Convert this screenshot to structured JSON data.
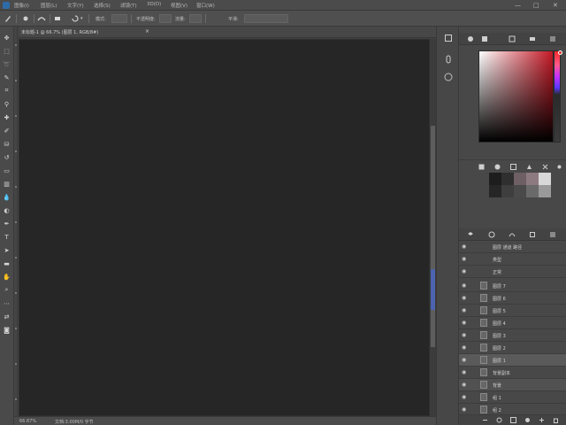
{
  "app": {
    "logo_icon": "app-logo-icon"
  },
  "menubar": {
    "items": [
      "图像(I)",
      "图层(L)",
      "文字(Y)",
      "选择(S)",
      "滤镜(T)",
      "3D(D)",
      "视图(V)",
      "窗口(W)"
    ],
    "window_controls": [
      "—",
      "□",
      "✕"
    ]
  },
  "optionsbar": {
    "mode_label": "模式:",
    "opacity_label": "不透明度:",
    "flow_label": "流量:",
    "smoothing_label": "平滑:"
  },
  "document": {
    "tab_label": "未标题-1 @ 66.7% (图层 1, RGB/8#)",
    "close": "×"
  },
  "statusbar": {
    "zoom": "66.67%",
    "doc_info": "文档:3.00M/0 字节"
  },
  "layers": {
    "header_rows": [
      {
        "label": "图层  通道  路径"
      },
      {
        "label": "类型"
      },
      {
        "label": "正常"
      }
    ],
    "items": [
      {
        "name": "图层 7",
        "selected": false
      },
      {
        "name": "图层 6",
        "selected": false
      },
      {
        "name": "图层 5",
        "selected": false
      },
      {
        "name": "图层 4",
        "selected": false
      },
      {
        "name": "图层 3",
        "selected": false
      },
      {
        "name": "图层 2",
        "selected": false
      },
      {
        "name": "图层 1",
        "selected": true
      },
      {
        "name": "背景副本",
        "selected": false
      },
      {
        "name": "背景",
        "selected": false
      },
      {
        "name": "组 1",
        "selected": false
      },
      {
        "name": "组 2",
        "selected": false
      },
      {
        "name": "效果",
        "selected": false
      }
    ]
  },
  "colors": {
    "accent": "#4c63b0",
    "picker_base": "#c41825",
    "canvas": "#262626",
    "panel": "#484848"
  },
  "swatches": [
    "#1d1d1d",
    "#2f2f2f",
    "#4a4a4a",
    "#6d5f63",
    "#8d7a80",
    "#b7b7b7",
    "#d8d8d8",
    "#9a9a9a"
  ]
}
